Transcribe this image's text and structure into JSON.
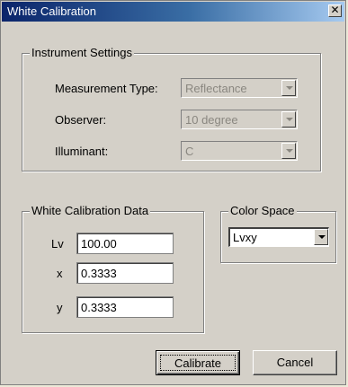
{
  "window": {
    "title": "White Calibration",
    "close_glyph": "✕"
  },
  "instrument_settings": {
    "legend": "Instrument Settings",
    "measurement_type": {
      "label": "Measurement Type:",
      "value": "Reflectance"
    },
    "observer": {
      "label": "Observer:",
      "value": "10 degree"
    },
    "illuminant": {
      "label": "Illuminant:",
      "value": "C"
    }
  },
  "white_calibration_data": {
    "legend": "White Calibration Data",
    "lv": {
      "label": "Lv",
      "value": "100.00"
    },
    "x": {
      "label": "x",
      "value": "0.3333"
    },
    "y": {
      "label": "y",
      "value": "0.3333"
    }
  },
  "color_space": {
    "legend": "Color Space",
    "value": "Lvxy"
  },
  "buttons": {
    "calibrate": "Calibrate",
    "cancel": "Cancel"
  },
  "colors": {
    "face": "#d4d0c8",
    "title_start": "#0a246a",
    "title_end": "#a6caf0",
    "disabled_text": "#8a8780"
  }
}
